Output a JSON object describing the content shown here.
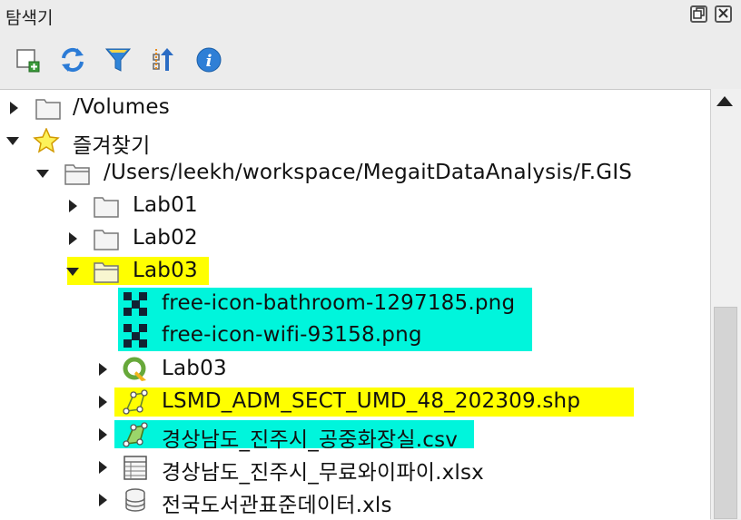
{
  "panel": {
    "title": "탐색기"
  },
  "toolbar": {
    "buttons": [
      {
        "icon": "add-layer-icon"
      },
      {
        "icon": "refresh-icon"
      },
      {
        "icon": "filter-icon"
      },
      {
        "icon": "collapse-all-icon"
      },
      {
        "icon": "info-icon"
      }
    ]
  },
  "tree": {
    "volumes": "/Volumes",
    "favorites": "즐겨찾기",
    "project_path": "/Users/leekh/workspace/MegaitDataAnalysis/F.GIS",
    "lab01": "Lab01",
    "lab02": "Lab02",
    "lab03_folder": "Lab03",
    "png1": "free-icon-bathroom-1297185.png",
    "png2": "free-icon-wifi-93158.png",
    "lab03_project": "Lab03",
    "shp": "LSMD_ADM_SECT_UMD_48_202309.shp",
    "csv": "경상남도_진주시_공중화장실.csv",
    "xlsx": "경상남도_진주시_무료와이파이.xlsx",
    "xls": "전국도서관표준데이터.xls"
  },
  "colors": {
    "highlight_yellow": "#ffff00",
    "highlight_cyan": "#00f5dc"
  }
}
